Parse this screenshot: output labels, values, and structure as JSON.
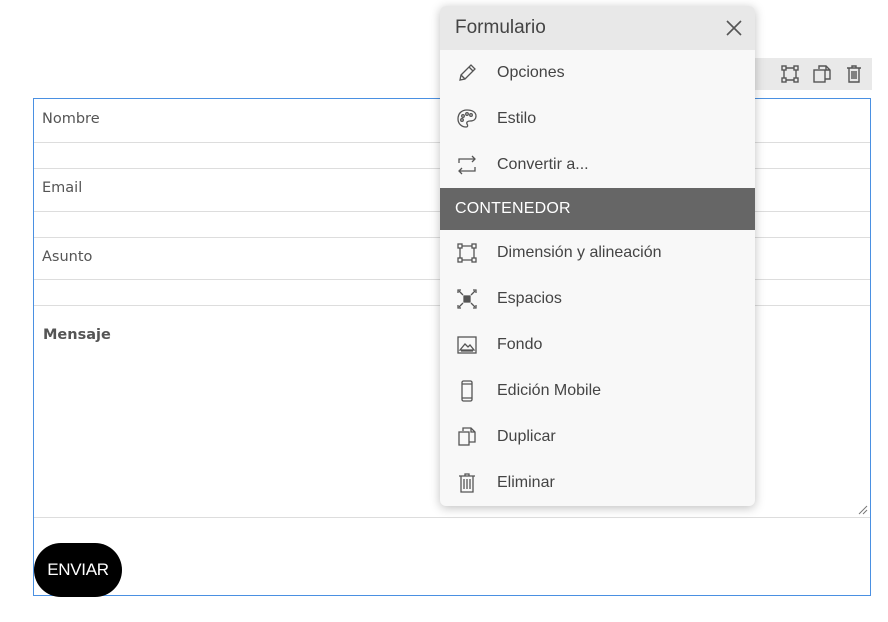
{
  "toolbar": {
    "icons": [
      "resize-icon",
      "dimension-icon",
      "duplicate-icon",
      "delete-icon"
    ]
  },
  "form": {
    "fields": [
      {
        "label": "Nombre"
      },
      {
        "label": "Email"
      },
      {
        "label": "Asunto"
      }
    ],
    "message_label": "Mensaje",
    "submit_label": "ENVIAR",
    "accent_color": "#4a90e2"
  },
  "menu": {
    "title": "Formulario",
    "items": [
      {
        "label": "Opciones",
        "icon": "pencil-icon"
      },
      {
        "label": "Estilo",
        "icon": "palette-icon"
      },
      {
        "label": "Convertir a...",
        "icon": "convert-icon"
      }
    ],
    "section_title": "CONTENEDOR",
    "container_items": [
      {
        "label": "Dimensión y alineación",
        "icon": "dimension-icon"
      },
      {
        "label": "Espacios",
        "icon": "spacing-icon"
      },
      {
        "label": "Fondo",
        "icon": "image-icon"
      },
      {
        "label": "Edición Mobile",
        "icon": "mobile-icon"
      },
      {
        "label": "Duplicar",
        "icon": "duplicate-icon"
      },
      {
        "label": "Eliminar",
        "icon": "trash-icon"
      }
    ]
  }
}
